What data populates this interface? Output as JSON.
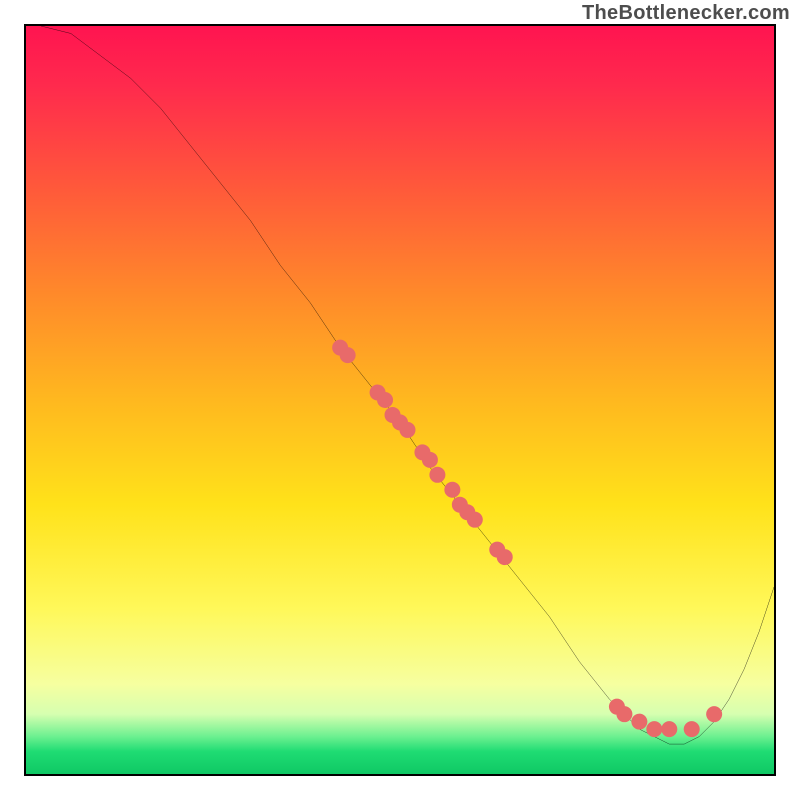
{
  "attribution": "TheBottlenecker.com",
  "chart_data": {
    "type": "line",
    "title": "",
    "xlabel": "",
    "ylabel": "",
    "xlim": [
      0,
      100
    ],
    "ylim": [
      0,
      100
    ],
    "legend": "none",
    "grid": false,
    "series": [
      {
        "name": "bottleneck-curve",
        "color": "#000000",
        "x": [
          2,
          6,
          10,
          14,
          18,
          22,
          26,
          30,
          34,
          38,
          42,
          46,
          50,
          54,
          58,
          62,
          66,
          70,
          74,
          78,
          80,
          82,
          84,
          86,
          88,
          90,
          92,
          94,
          96,
          98,
          100
        ],
        "y": [
          100,
          99,
          96,
          93,
          89,
          84,
          79,
          74,
          68,
          63,
          57,
          52,
          47,
          41,
          36,
          31,
          26,
          21,
          15,
          10,
          8,
          6,
          5,
          4,
          4,
          5,
          7,
          10,
          14,
          19,
          25
        ]
      }
    ],
    "markers": [
      {
        "name": "curve-points",
        "color": "#e86a6a",
        "shape": "circle",
        "radius": 8,
        "points": [
          {
            "x": 42,
            "y": 57
          },
          {
            "x": 43,
            "y": 56
          },
          {
            "x": 47,
            "y": 51
          },
          {
            "x": 48,
            "y": 50
          },
          {
            "x": 49,
            "y": 48
          },
          {
            "x": 50,
            "y": 47
          },
          {
            "x": 51,
            "y": 46
          },
          {
            "x": 53,
            "y": 43
          },
          {
            "x": 54,
            "y": 42
          },
          {
            "x": 55,
            "y": 40
          },
          {
            "x": 57,
            "y": 38
          },
          {
            "x": 58,
            "y": 36
          },
          {
            "x": 59,
            "y": 35
          },
          {
            "x": 60,
            "y": 34
          },
          {
            "x": 63,
            "y": 30
          },
          {
            "x": 64,
            "y": 29
          },
          {
            "x": 79,
            "y": 9
          },
          {
            "x": 80,
            "y": 8
          },
          {
            "x": 82,
            "y": 7
          },
          {
            "x": 84,
            "y": 6
          },
          {
            "x": 86,
            "y": 6
          },
          {
            "x": 89,
            "y": 6
          },
          {
            "x": 92,
            "y": 8
          }
        ]
      }
    ],
    "background_gradient": {
      "orientation": "vertical",
      "stops": [
        {
          "pos": 0.0,
          "color": "#ff1450"
        },
        {
          "pos": 0.5,
          "color": "#ffe21a"
        },
        {
          "pos": 0.92,
          "color": "#d6ffb0"
        },
        {
          "pos": 1.0,
          "color": "#0fc864"
        }
      ]
    }
  }
}
